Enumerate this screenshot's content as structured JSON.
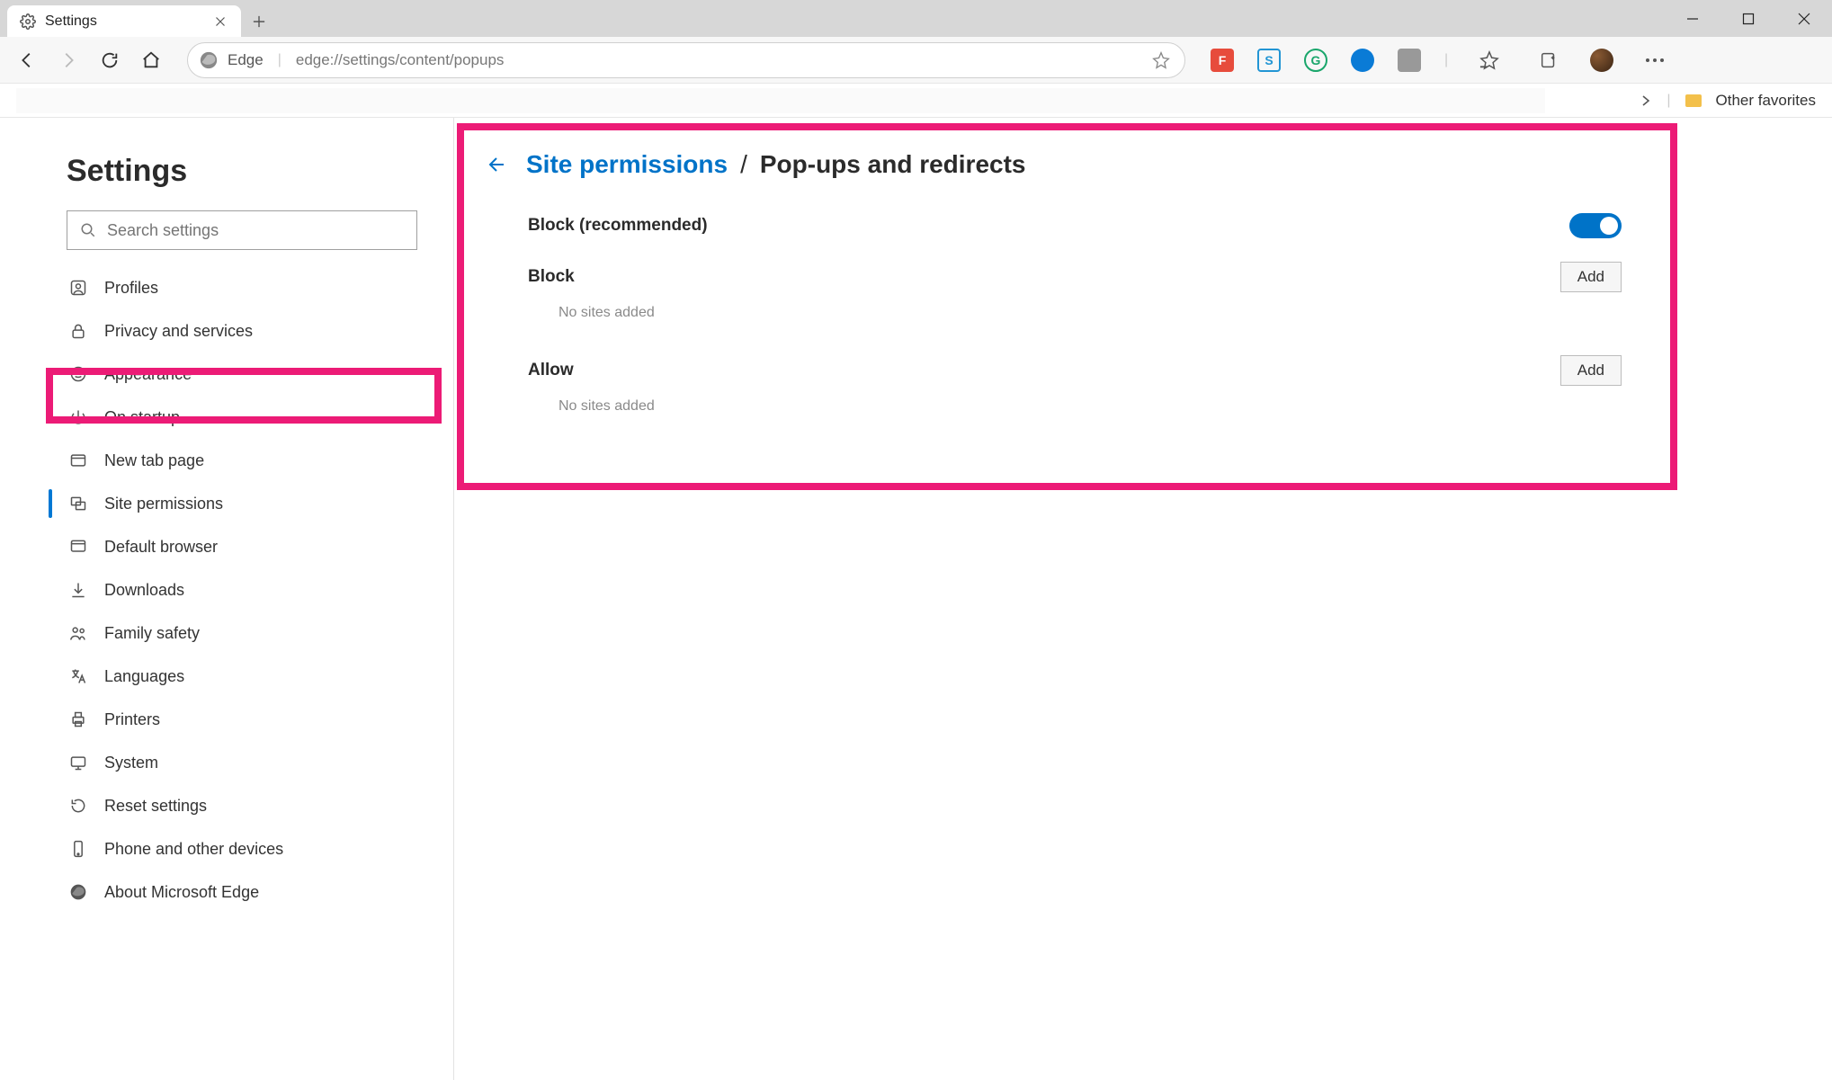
{
  "window": {
    "tab_title": "Settings"
  },
  "toolbar": {
    "edge_label": "Edge",
    "url": "edge://settings/content/popups"
  },
  "bookmarks": {
    "other_favorites": "Other favorites"
  },
  "sidebar": {
    "title": "Settings",
    "search_placeholder": "Search settings",
    "items": [
      {
        "label": "Profiles"
      },
      {
        "label": "Privacy and services"
      },
      {
        "label": "Appearance"
      },
      {
        "label": "On startup"
      },
      {
        "label": "New tab page"
      },
      {
        "label": "Site permissions"
      },
      {
        "label": "Default browser"
      },
      {
        "label": "Downloads"
      },
      {
        "label": "Family safety"
      },
      {
        "label": "Languages"
      },
      {
        "label": "Printers"
      },
      {
        "label": "System"
      },
      {
        "label": "Reset settings"
      },
      {
        "label": "Phone and other devices"
      },
      {
        "label": "About Microsoft Edge"
      }
    ],
    "active_index": 5
  },
  "main": {
    "breadcrumb_parent": "Site permissions",
    "breadcrumb_sep": "/",
    "breadcrumb_current": "Pop-ups and redirects",
    "block_recommended": "Block (recommended)",
    "block_title": "Block",
    "block_empty": "No sites added",
    "allow_title": "Allow",
    "allow_empty": "No sites added",
    "add_label": "Add"
  },
  "highlight_color": "#ec1b76"
}
